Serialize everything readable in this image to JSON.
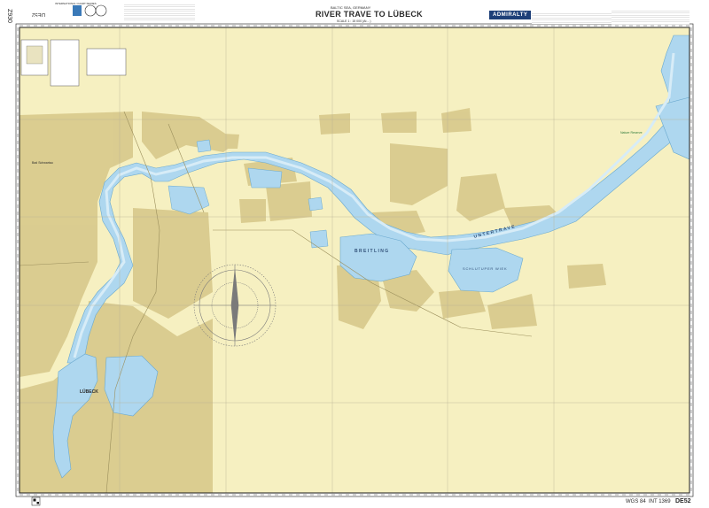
{
  "chart": {
    "publisher_line": "INTERNATIONAL CHART SERIES",
    "region": "BALTIC SEA, GERMANY",
    "title": "RIVER TRAVE TO LÜBECK",
    "scale": "SCALE 1 : 15 000 (At ...)",
    "brand": "ADMIRALTY",
    "chart_number_vertical": "Z930",
    "code_top_left": "DE52",
    "footer_datum": "WGS 84",
    "footer_int": "INT 1369",
    "footer_number": "DE52"
  },
  "labels": {
    "lubeck": "LÜBECK",
    "untertrave": "UNTERTRAVE",
    "breitling": "BREITLING",
    "schlutuper_wiek": "SCHLUTUPER WIEK",
    "bad_schwartau": "Bad Schwartau",
    "nature_reserve": "Nature Reserve"
  },
  "colors": {
    "land": "#f6f0c1",
    "built_up": "#d8c98b",
    "water": "#aed7ef",
    "deep_water": "#d7ecf7",
    "border": "#1a1a1a",
    "title": "#1a1a1a",
    "brand": "#1d3f78"
  },
  "icons": [
    "compass-rose-icon",
    "admiralty-logo-icon",
    "iho-seal-icon",
    "qr-code-icon"
  ]
}
